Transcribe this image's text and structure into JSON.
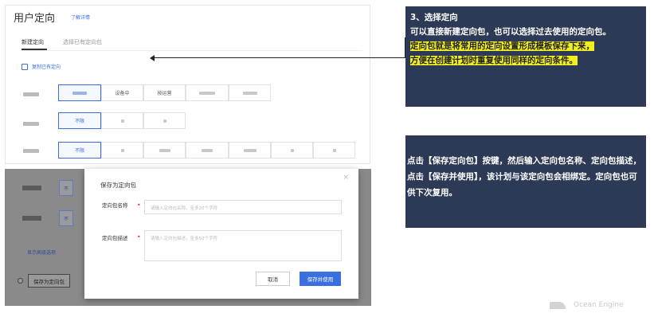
{
  "top": {
    "title": "用户定向",
    "link": "了解详情",
    "tabs": [
      "新建定向",
      "选择已有定向包"
    ],
    "copy": "复制已有定向",
    "row2_first": "不限",
    "row3_first": "不限",
    "row1_opts": [
      "",
      "",
      "设备中",
      "按运营",
      "",
      ""
    ]
  },
  "callout1": {
    "line1": "3、选择定向",
    "line2": "可以直接新建定向包，也可以选择过去使用的定向包。",
    "line3": "定向包就是将常用的定向设置形成模板保存下来，",
    "line4": "方便在创建计划时重复使用同样的定向条件。"
  },
  "callout2": {
    "text": "点击【保存定向包】按键，然后输入定向包名称、定向包描述，点击【保存并使用】，该计划与该定向包会相绑定。定向包也可供下次复用。"
  },
  "dimmed": {
    "opt1": "不",
    "opt2": "不",
    "advanced": "显示高级选项",
    "save_pkg": "保存为定向包"
  },
  "modal": {
    "title": "保存为定向包",
    "close": "×",
    "name_label": "定向包名称",
    "name_placeholder": "请输入定向包名称，至多20个字符",
    "desc_label": "定向包描述",
    "desc_placeholder": "请输入定向包描述，至多50个字符",
    "required": "•",
    "cancel": "取消",
    "save_use": "保存并使用"
  },
  "watermark": {
    "text": "Ocean Engine"
  },
  "colors": {
    "accent": "#3a6fe0",
    "callout_bg": "#2d3a55",
    "highlight": "#f2ef1e"
  }
}
